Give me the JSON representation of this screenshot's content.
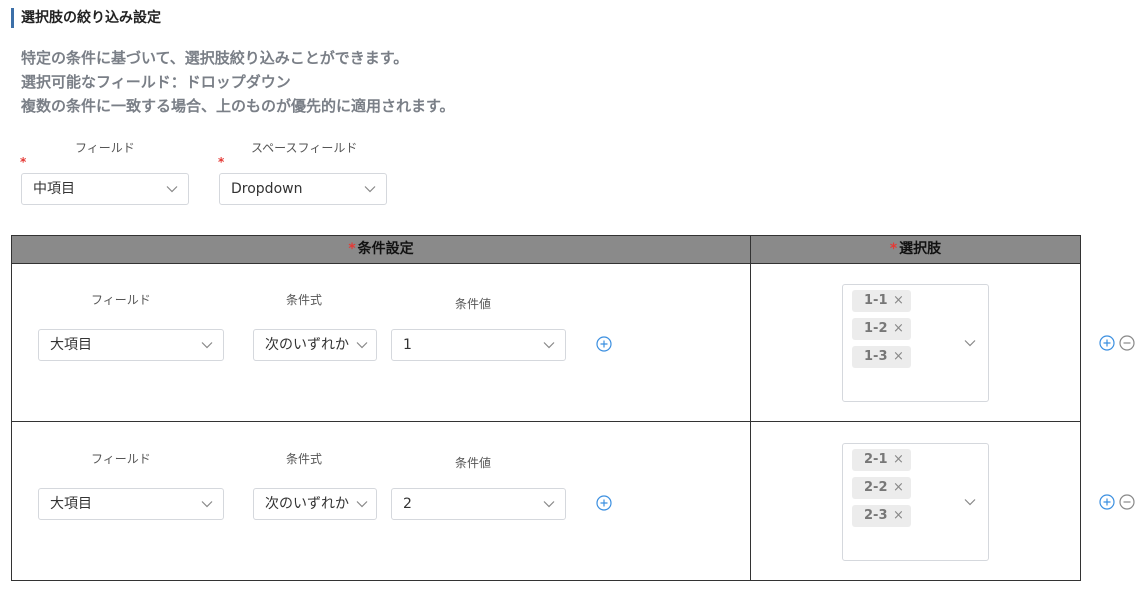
{
  "section": {
    "title": "選択肢の絞り込み設定"
  },
  "description": [
    "特定の条件に基づいて、選択肢絞り込みことができます。",
    "選択可能なフィールド：ドロップダウン",
    "複数の条件に一致する場合、上のものが優先的に適用されます。"
  ],
  "top_fields": {
    "field": {
      "label": "フィールド",
      "value": "中項目",
      "required_mark": "*"
    },
    "space_field": {
      "label": "スペースフィールド",
      "value": "Dropdown",
      "required_mark": "*"
    }
  },
  "table": {
    "headers": [
      {
        "label": "条件設定",
        "required_mark": "*"
      },
      {
        "label": "選択肢",
        "required_mark": "*"
      }
    ],
    "rows": [
      {
        "field_label": "フィールド",
        "field_value": "大項目",
        "op_label": "条件式",
        "op_value": "次のいずれか",
        "val_label": "条件値",
        "val_value": "1",
        "choices": [
          {
            "text": "1-1",
            "remove": "×"
          },
          {
            "text": "1-2",
            "remove": "×"
          },
          {
            "text": "1-3",
            "remove": "×"
          }
        ]
      },
      {
        "field_label": "フィールド",
        "field_value": "大項目",
        "op_label": "条件式",
        "op_value": "次のいずれか",
        "val_label": "条件値",
        "val_value": "2",
        "choices": [
          {
            "text": "2-1",
            "remove": "×"
          },
          {
            "text": "2-2",
            "remove": "×"
          },
          {
            "text": "2-3",
            "remove": "×"
          }
        ]
      }
    ]
  },
  "icons": {
    "add": "plus-circle-icon",
    "remove": "minus-circle-icon",
    "dropdown": "chevron-down-icon"
  },
  "colors": {
    "accent": "#3c6fa8",
    "required": "#e53935",
    "add_icon": "#3b8fe0",
    "header_bg": "#8a8a8a"
  }
}
